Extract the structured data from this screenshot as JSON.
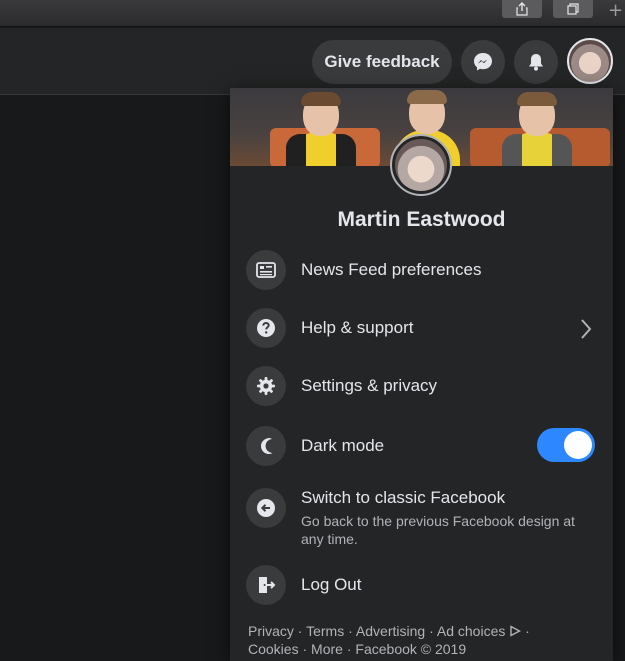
{
  "browser": {
    "share_icon": "share-icon",
    "tabs_icon": "tabs-icon",
    "new_tab_label": "+"
  },
  "topbar": {
    "feedback_label": "Give feedback",
    "messenger_icon": "messenger-icon",
    "notifications_icon": "bell-icon"
  },
  "menu": {
    "profile_name": "Martin Eastwood",
    "items": [
      {
        "label": "News Feed preferences",
        "icon": "news-feed-icon"
      },
      {
        "label": "Help & support",
        "icon": "question-icon"
      },
      {
        "label": "Settings & privacy",
        "icon": "gear-icon"
      },
      {
        "label": "Dark mode",
        "icon": "moon-icon",
        "enabled": true
      },
      {
        "label": "Switch to classic Facebook",
        "sublabel": "Go back to the previous Facebook design at any time.",
        "icon": "arrow-left-icon"
      },
      {
        "label": "Log Out",
        "icon": "logout-icon"
      }
    ],
    "footer": {
      "privacy": "Privacy",
      "terms": "Terms",
      "advertising": "Advertising",
      "ad_choices": "Ad choices",
      "cookies": "Cookies",
      "more": "More",
      "copyright": "Facebook © 2019",
      "separator": "·"
    }
  },
  "colors": {
    "background": "#18191a",
    "surface": "#242526",
    "button": "#3a3b3c",
    "text": "#e4e6eb",
    "secondary_text": "#b0b3b8",
    "accent": "#2d88ff"
  }
}
